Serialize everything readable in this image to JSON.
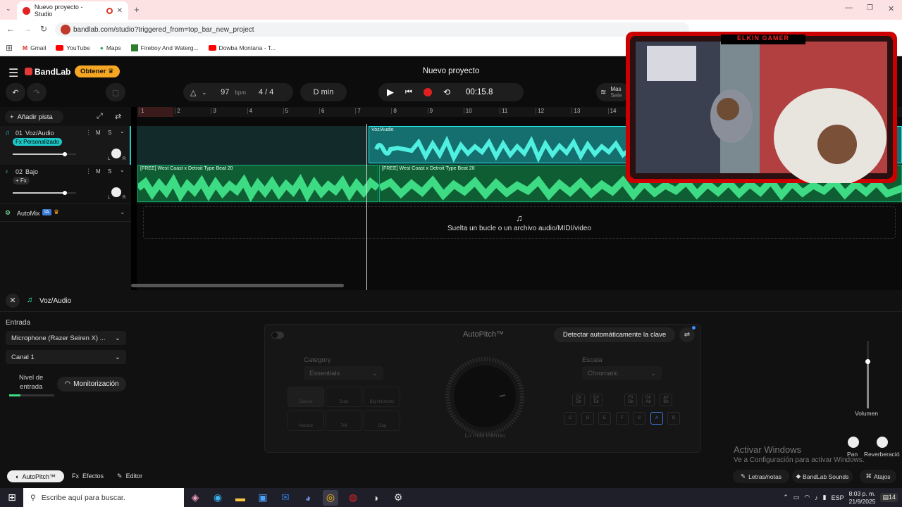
{
  "browser": {
    "tab_title": "Nuevo proyecto - Studio",
    "url": "bandlab.com/studio?triggered_from=top_bar_new_project",
    "bookmarks": [
      "Gmail",
      "YouTube",
      "Maps",
      "Fireboy And Waterg...",
      "Dowba Montana - T..."
    ]
  },
  "studio": {
    "logo": "BandLab",
    "get_button": "Obtener",
    "project_title": "Nuevo proyecto",
    "bpm": "97",
    "bpm_unit": "bpm",
    "time_sig_num": "4",
    "time_sig_sep": "/",
    "time_sig_den": "4",
    "key": "D min",
    "time": "00:15.8",
    "master_label": "Mas",
    "master_sub": "Sele",
    "add_track": "Añadir pista"
  },
  "ruler": [
    "1",
    "2",
    "3",
    "4",
    "5",
    "6",
    "7",
    "8",
    "9",
    "10",
    "11",
    "12",
    "13",
    "14"
  ],
  "tracks": [
    {
      "num": "01",
      "name": "Voz/Audio",
      "fx": "Fx Personalizado",
      "m": "M",
      "s": "S",
      "pan_l": "L",
      "pan_r": "R",
      "volume": 0.82
    },
    {
      "num": "02",
      "name": "Bajo",
      "fx": "+ Fx",
      "m": "M",
      "s": "S",
      "pan_l": "L",
      "pan_r": "R",
      "volume": 0.82
    }
  ],
  "automix": {
    "label": "AutoMix",
    "badge": "IA"
  },
  "regions": {
    "voice_region": "Voz/Audio",
    "beat_region_1": "[FREE] West Coast x Detroit Type Beat 20",
    "beat_region_2": "[FREE] West Coast x Detroit Type Beat 20"
  },
  "drop_zone": "Suelta un bucle o un archivo audio/MIDI/video",
  "bottom_panel": {
    "track_name": "Voz/Audio",
    "input_label": "Entrada",
    "input_device": "Microphone (Razer Seiren X) ...",
    "channel": "Canal 1",
    "level_label_1": "Nivel de",
    "level_label_2": "entrada",
    "monitor_button": "Monitorización",
    "volume_label": "Volumen",
    "pan_label": "Pan",
    "reverb_label": "Reverberació"
  },
  "autopitch": {
    "title": "AutoPitch™",
    "detect_button": "Detectar automáticamente la clave",
    "category_label": "Category",
    "category_value": "Essentials",
    "scale_label": "Escala",
    "scale_value": "Chromatic",
    "intensity_label": "Lo más intenso",
    "presets": [
      "Classic",
      "Duet",
      "Big Harmony",
      "Natural",
      "Trill",
      "Clap"
    ],
    "sharps": [
      "C#\nDb",
      "D#\nEb",
      "F#\nGb",
      "G#\nAb",
      "A#\nBb"
    ],
    "naturals": [
      "C",
      "D",
      "E",
      "F",
      "G",
      "A",
      "B"
    ],
    "selected_note": "A"
  },
  "footer": {
    "tabs": [
      "AutoPitch™",
      "Efectos",
      "Editor"
    ],
    "fx_prefix": "Fx",
    "right_buttons": [
      "Letras/notas",
      "BandLab Sounds",
      "Atajos"
    ]
  },
  "watermark": {
    "line1": "Activar Windows",
    "line2": "Ve a Configuración para activar Windows."
  },
  "webcam": {
    "banner": "ELKIN GAMER"
  },
  "taskbar": {
    "search_placeholder": "Escribe aquí para buscar.",
    "clock_time": "8:03 p. m.",
    "clock_date": "21/9/2025",
    "lang": "ESP",
    "notif_count": "14"
  }
}
